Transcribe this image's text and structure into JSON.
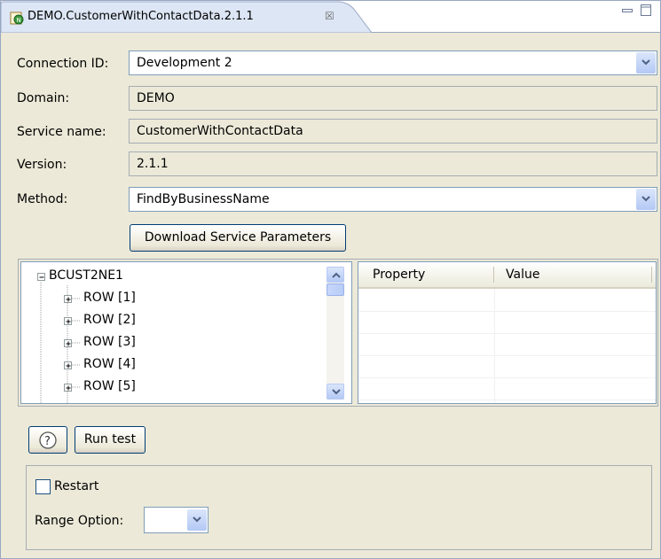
{
  "tab": {
    "title": "DEMO.CustomerWithContactData.2.1.1",
    "close_glyph": "☒",
    "icon": "service-icon"
  },
  "window_controls": {
    "minimize_icon": "minimize-icon",
    "maximize_icon": "maximize-icon"
  },
  "form": {
    "connection_label": "Connection ID:",
    "connection_value": "Development 2",
    "domain_label": "Domain:",
    "domain_value": "DEMO",
    "service_label": "Service name:",
    "service_value": "CustomerWithContactData",
    "version_label": "Version:",
    "version_value": "2.1.1",
    "method_label": "Method:",
    "method_value": "FindByBusinessName",
    "download_button": "Download Service Parameters"
  },
  "tree": {
    "root": "BCUST2NE1",
    "rows": [
      "ROW [1]",
      "ROW [2]",
      "ROW [3]",
      "ROW [4]",
      "ROW [5]"
    ]
  },
  "properties": {
    "columns": [
      "Property",
      "Value"
    ]
  },
  "actions": {
    "help_glyph": "?",
    "run_test": "Run test"
  },
  "options": {
    "restart_label": "Restart",
    "restart_checked": false,
    "range_label": "Range Option:",
    "range_value": ""
  },
  "colors": {
    "accent": "#7f9db9",
    "panel_bg": "#ece9d8",
    "button_border": "#003c74"
  }
}
